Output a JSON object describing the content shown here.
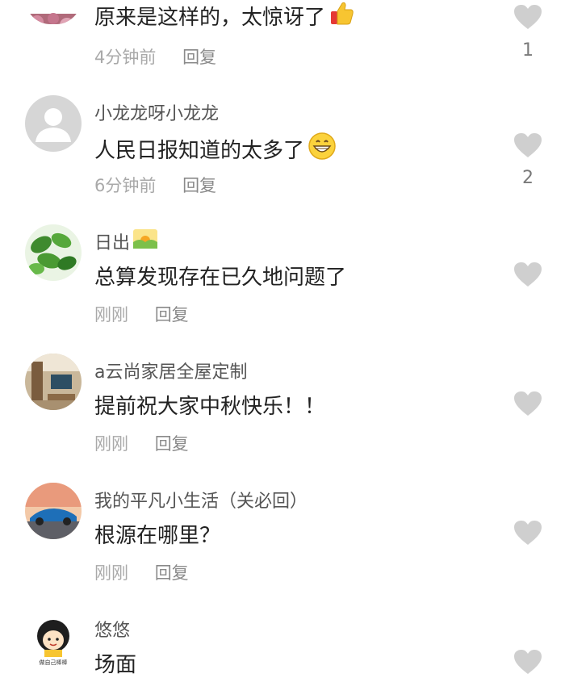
{
  "comments": [
    {
      "username": "",
      "text": "原来是这样的，太惊讶了",
      "emoji": "thumbs-up-icon",
      "time": "4分钟前",
      "reply": "回复",
      "likes": "1"
    },
    {
      "username": "小龙龙呀小龙龙",
      "text": "人民日报知道的太多了",
      "emoji": "grinning-face-icon",
      "time": "6分钟前",
      "reply": "回复",
      "likes": "2"
    },
    {
      "username": "日出",
      "text": "总算发现存在已久地问题了",
      "emoji": "sunrise-icon",
      "time": "刚刚",
      "reply": "回复",
      "likes": ""
    },
    {
      "username": "a云尚家居全屋定制",
      "text": "提前祝大家中秋快乐！！",
      "emoji": "",
      "time": "刚刚",
      "reply": "回复",
      "likes": ""
    },
    {
      "username": "我的平凡小生活（关必回）",
      "text": "根源在哪里？",
      "emoji": "",
      "time": "刚刚",
      "reply": "回复",
      "likes": ""
    },
    {
      "username": "悠悠",
      "text": "场面",
      "emoji": "",
      "time": "",
      "reply": "",
      "likes": "",
      "avatar_caption": "做自己棒棒"
    }
  ],
  "colors": {
    "heart": "#cfcfcf",
    "meta": "#a9a9a9",
    "username": "#555555",
    "text": "#222222"
  }
}
